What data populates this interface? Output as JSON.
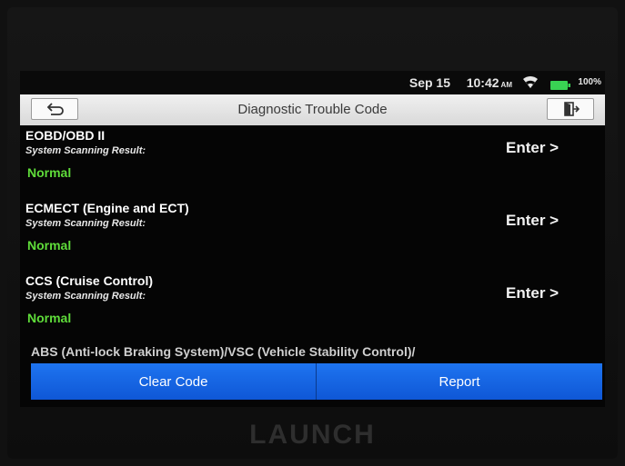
{
  "status": {
    "date": "Sep 15",
    "time": "10:42",
    "ampm": "AM",
    "battery": "100%",
    "battery_color": "#39d353",
    "wifi_icon": "wifi-icon"
  },
  "titlebar": {
    "title": "Diagnostic Trouble Code",
    "back_icon": "back-arrow-icon",
    "exit_icon": "exit-icon"
  },
  "systems": [
    {
      "name": "EOBD/OBD II",
      "subtitle": "System Scanning Result:",
      "status": "Normal",
      "action": "Enter >"
    },
    {
      "name": "ECMECT (Engine and ECT)",
      "subtitle": "System Scanning Result:",
      "status": "Normal",
      "action": "Enter >"
    },
    {
      "name": "CCS (Cruise Control)",
      "subtitle": "System Scanning Result:",
      "status": "Normal",
      "action": "Enter >"
    }
  ],
  "partial_item": "ABS (Anti-lock Braking System)/VSC (Vehicle Stability Control)/",
  "actions": {
    "clear": "Clear Code",
    "report": "Report"
  },
  "colors": {
    "accent": "#1565e0",
    "status_normal": "#5fdc3a"
  },
  "brand": "LAUNCH"
}
